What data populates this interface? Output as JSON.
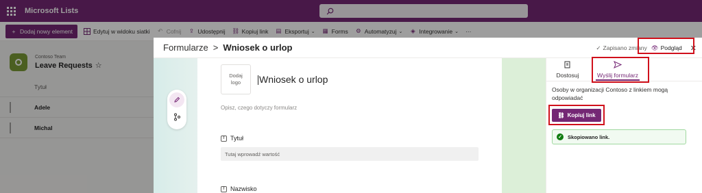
{
  "suitebar": {
    "app_name": "Microsoft Lists"
  },
  "commandbar": {
    "items": [
      {
        "label": "Dodaj nowy element",
        "icon": "plus-icon"
      },
      {
        "label": "Edytuj w widoku siatki",
        "icon": "grid-icon"
      },
      {
        "label": "Cofnij",
        "icon": "undo-icon"
      },
      {
        "label": "Udostępnij",
        "icon": "share-icon"
      },
      {
        "label": "Kopiuj link",
        "icon": "link-icon"
      },
      {
        "label": "Eksportuj",
        "icon": "export-icon"
      },
      {
        "label": "Forms",
        "icon": "forms-icon"
      },
      {
        "label": "Automatyzuj",
        "icon": "automate-icon"
      },
      {
        "label": "Integrowanie",
        "icon": "integrate-icon"
      },
      {
        "label": "···",
        "icon": "more-icon"
      }
    ]
  },
  "list": {
    "team": "Contoso Team",
    "name": "Leave Requests",
    "star": "☆",
    "column_title": "Tytuł",
    "rows": [
      "Adele",
      "Michal"
    ]
  },
  "panel": {
    "breadcrumb_root": "Formularze",
    "breadcrumb_sep": ">",
    "breadcrumb_current": "Wniosek o urlop",
    "saved_status": "Zapisano zmiany",
    "preview_label": "Podgląd",
    "close_glyph": "✕"
  },
  "form": {
    "logo_placeholder": "Dodaj\nlogo",
    "title": "Wniosek o urlop",
    "description_placeholder": "Opisz, czego dotyczy formularz",
    "fields": [
      {
        "label": "Tytuł",
        "placeholder": "Tutaj wprowadź wartość"
      },
      {
        "label": "Nazwisko"
      }
    ]
  },
  "rpane": {
    "tabs": [
      {
        "label": "Dostosuj",
        "icon": "customize-icon"
      },
      {
        "label": "Wyślij formularz",
        "icon": "send-icon"
      }
    ],
    "share_text": "Osoby w organizacji Contoso z linkiem mogą odpowiadać",
    "copy_button": "Kopiuj link",
    "toast": "Skopiowano link."
  },
  "colors": {
    "brand": "#742774",
    "highlight": "#d0101b",
    "success": "#107c10"
  }
}
